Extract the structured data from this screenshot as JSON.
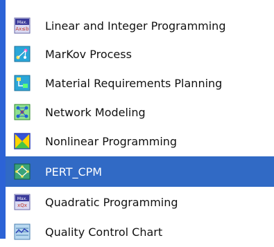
{
  "list": {
    "items": [
      {
        "label": "Linear and Integer Programming",
        "icon": "lp-icon",
        "selected": false
      },
      {
        "label": "MarKov Process",
        "icon": "markov-icon",
        "selected": false
      },
      {
        "label": "Material Requirements Planning",
        "icon": "mrp-icon",
        "selected": false
      },
      {
        "label": "Network Modeling",
        "icon": "network-icon",
        "selected": false
      },
      {
        "label": "Nonlinear Programming",
        "icon": "nlp-icon",
        "selected": false
      },
      {
        "label": "PERT_CPM",
        "icon": "pert-icon",
        "selected": true
      },
      {
        "label": "Quadratic Programming",
        "icon": "qp-icon",
        "selected": false
      },
      {
        "label": "Quality Control Chart",
        "icon": "qcc-icon",
        "selected": false
      }
    ]
  },
  "colors": {
    "selection": "#316ac5",
    "left_strip": "#2c63d6",
    "text": "#111111"
  }
}
